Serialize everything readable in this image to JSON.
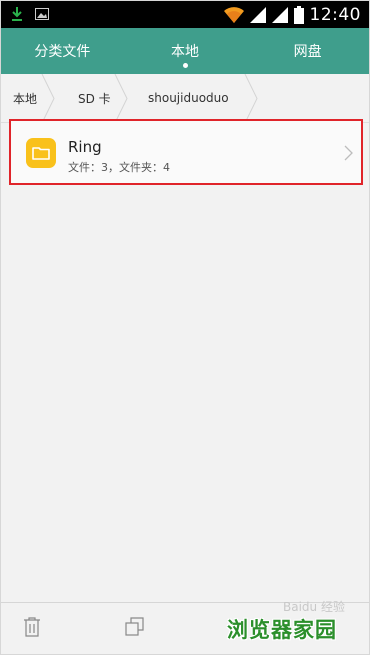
{
  "status_bar": {
    "time": "12:40",
    "icons": [
      "download-icon",
      "image-icon",
      "wifi-icon",
      "signal-icon",
      "signal-icon",
      "battery-icon"
    ]
  },
  "tabs": [
    {
      "label": "分类文件",
      "active": false
    },
    {
      "label": "本地",
      "active": true
    },
    {
      "label": "网盘",
      "active": false
    }
  ],
  "breadcrumb": [
    "本地",
    "SD 卡",
    "shoujiduoduo"
  ],
  "list": [
    {
      "name": "Ring",
      "detail": "文件：3，文件夹：4",
      "icon": "folder-icon"
    }
  ],
  "bottom_bar": {
    "actions": [
      "delete-icon",
      "copy-icon"
    ]
  },
  "watermark": {
    "main": "浏览器家园",
    "faint": "Baidu 经验"
  },
  "colors": {
    "accent": "#3f9e8c",
    "folder": "#f9c11b",
    "highlight_border": "#e0242a",
    "watermark": "#2b8f2b"
  }
}
